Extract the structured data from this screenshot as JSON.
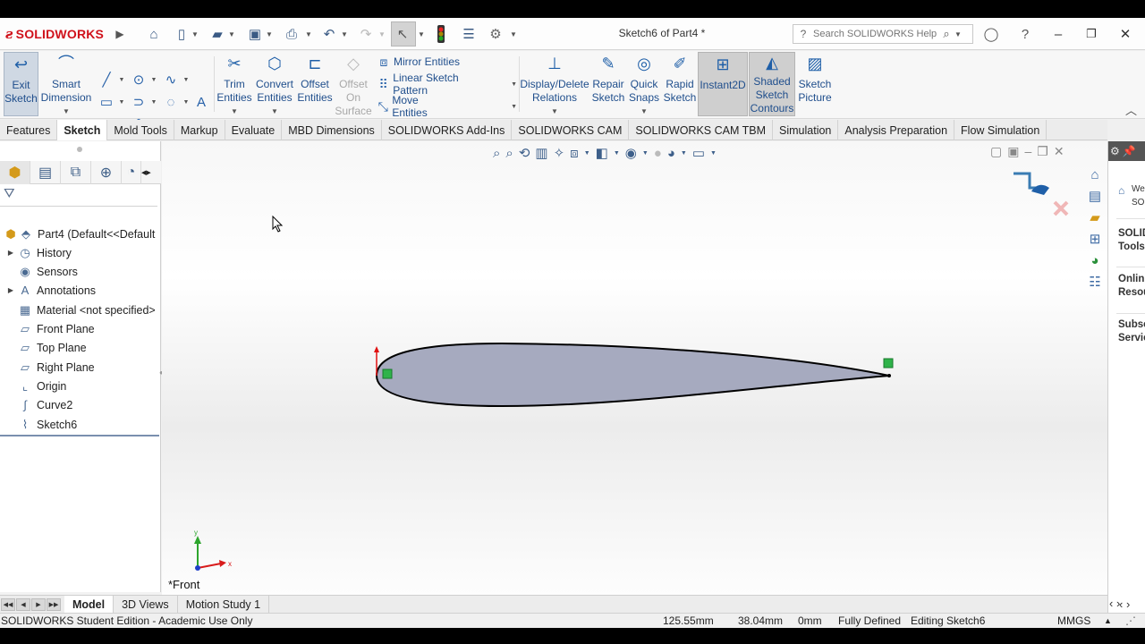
{
  "app": {
    "brand": "SOLIDWORKS",
    "document_title": "Sketch6 of Part4 *"
  },
  "search": {
    "placeholder": "Search SOLIDWORKS Help"
  },
  "ribbon": {
    "exit_sketch": [
      "Exit",
      "Sketch"
    ],
    "smart_dimension": [
      "Smart",
      "Dimension"
    ],
    "trim_entities": [
      "Trim",
      "Entities"
    ],
    "convert_entities": [
      "Convert",
      "Entities"
    ],
    "offset_entities": [
      "Offset",
      "Entities"
    ],
    "offset_on_surface": [
      "Offset",
      "On",
      "Surface"
    ],
    "mirror_entities": "Mirror Entities",
    "linear_sketch_pattern": "Linear Sketch Pattern",
    "move_entities": "Move Entities",
    "display_delete_relations": [
      "Display/Delete",
      "Relations"
    ],
    "repair_sketch": [
      "Repair",
      "Sketch"
    ],
    "quick_snaps": [
      "Quick",
      "Snaps"
    ],
    "rapid_sketch": [
      "Rapid",
      "Sketch"
    ],
    "instant2d": "Instant2D",
    "shaded_sketch_contours": [
      "Shaded",
      "Sketch",
      "Contours"
    ],
    "sketch_picture": [
      "Sketch",
      "Picture"
    ]
  },
  "tabs": [
    "Features",
    "Sketch",
    "Mold Tools",
    "Markup",
    "Evaluate",
    "MBD Dimensions",
    "SOLIDWORKS Add-Ins",
    "SOLIDWORKS CAM",
    "SOLIDWORKS CAM TBM",
    "Simulation",
    "Analysis Preparation",
    "Flow Simulation"
  ],
  "active_tab": "Sketch",
  "feature_tree": {
    "root": "Part4  (Default<<Default",
    "items": [
      {
        "label": "History",
        "icon": "history-icon",
        "expandable": true
      },
      {
        "label": "Sensors",
        "icon": "sensors-icon",
        "expandable": false
      },
      {
        "label": "Annotations",
        "icon": "annotations-icon",
        "expandable": true
      },
      {
        "label": "Material <not specified>",
        "icon": "material-icon",
        "expandable": false
      },
      {
        "label": "Front Plane",
        "icon": "plane-icon",
        "expandable": false
      },
      {
        "label": "Top Plane",
        "icon": "plane-icon",
        "expandable": false
      },
      {
        "label": "Right Plane",
        "icon": "plane-icon",
        "expandable": false
      },
      {
        "label": "Origin",
        "icon": "origin-icon",
        "expandable": false
      },
      {
        "label": "Curve2",
        "icon": "curve-icon",
        "expandable": false
      },
      {
        "label": "Sketch6",
        "icon": "sketch-icon",
        "expandable": false
      }
    ]
  },
  "graphics": {
    "view_label": "*Front",
    "triad_x": "x",
    "triad_y": "y"
  },
  "task_pane": {
    "welcome": [
      "We",
      "SO"
    ],
    "solidworks_tools": [
      "SOLID",
      "Tools"
    ],
    "online_resources": [
      "Onlin",
      "Resou"
    ],
    "subscription_services": [
      "Subsc",
      "Servic"
    ]
  },
  "bottom_tabs": [
    "Model",
    "3D Views",
    "Motion Study 1"
  ],
  "active_bottom_tab": "Model",
  "status": {
    "edition": "SOLIDWORKS Student Edition - Academic Use Only",
    "x": "125.55mm",
    "y": "38.04mm",
    "z": "0mm",
    "state": "Fully Defined",
    "editing": "Editing Sketch6",
    "units": "MMGS",
    "units_arrow": "▲"
  },
  "colors": {
    "brand_red": "#d0111b",
    "sketch_fill": "#a6aabf",
    "relation_green": "#2fb34a",
    "accent_blue": "#1f5fa8"
  }
}
